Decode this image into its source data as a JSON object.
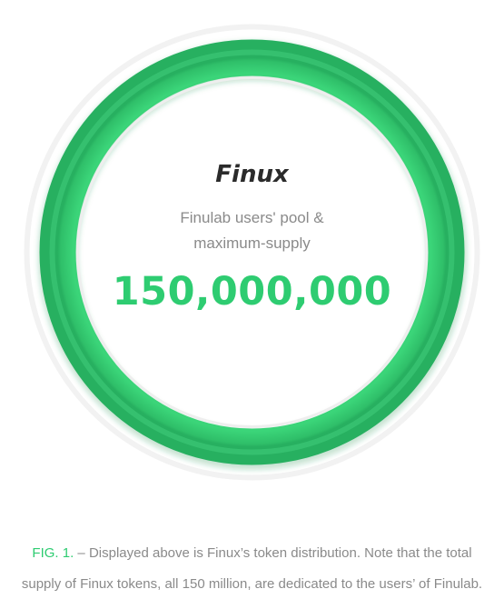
{
  "figure": {
    "token_name": "Finux",
    "subtitle_line1": "Finulab users' pool &",
    "subtitle_line2": "maximum-supply",
    "supply_value": "150,000,000"
  },
  "caption": {
    "lead": "FIG. 1.",
    "line1_rest": " – Displayed above is Finux’s token distribution. Note that the total",
    "line2": "supply of Finux tokens, all 150 million, are dedicated to the users’ of Finulab."
  },
  "colors": {
    "accent_green": "#2ecc71",
    "ring_green": "#33c96f",
    "text_dark": "#2b2b2b",
    "text_muted": "#8a8a8a"
  },
  "distribution": {
    "users_pool_fraction": 1.0
  }
}
